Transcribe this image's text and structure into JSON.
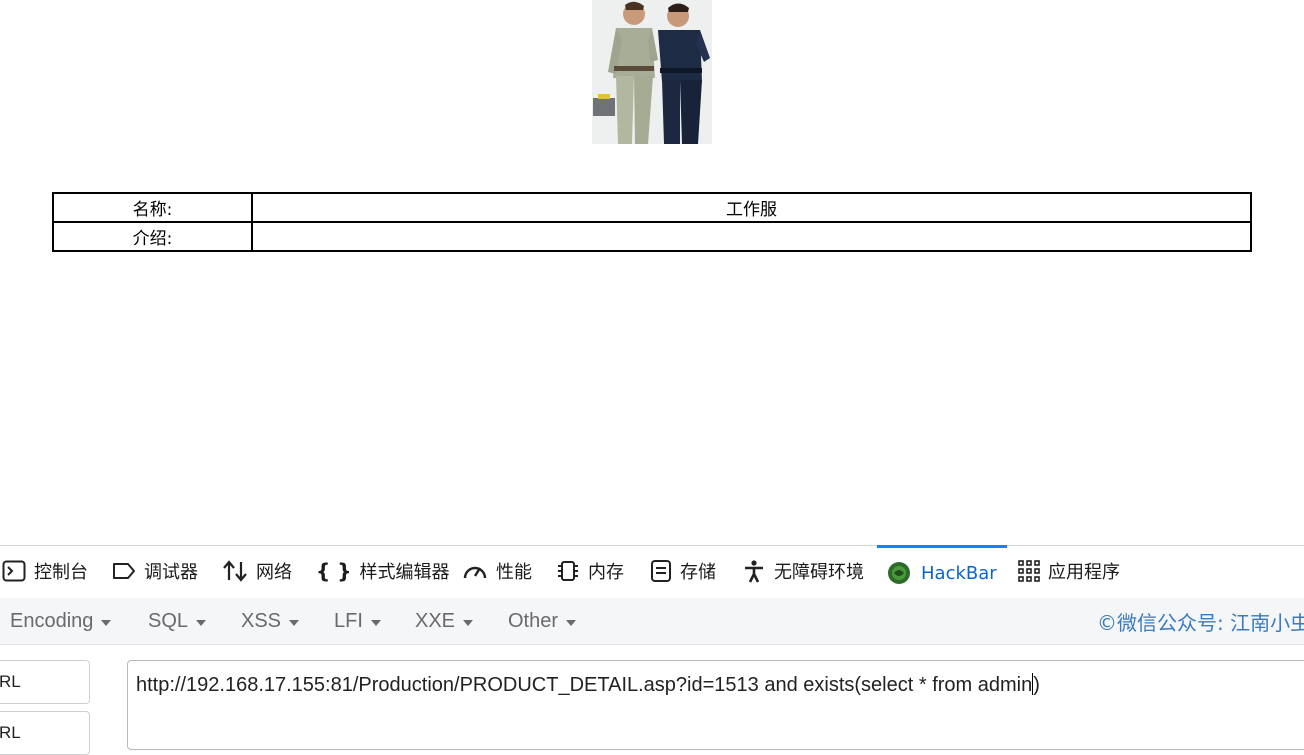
{
  "product": {
    "image_alt": "product photo: two men in work uniforms",
    "rows": [
      {
        "label": "名称:",
        "value": "工作服"
      },
      {
        "label": "介绍:",
        "value": ""
      }
    ]
  },
  "devtools": {
    "tabs": [
      {
        "label": "控制台",
        "icon": "console-icon"
      },
      {
        "label": "调试器",
        "icon": "debugger-icon"
      },
      {
        "label": "网络",
        "icon": "network-icon"
      },
      {
        "label": "样式编辑器",
        "icon": "style-editor-icon"
      },
      {
        "label": "性能",
        "icon": "performance-icon"
      },
      {
        "label": "内存",
        "icon": "memory-icon"
      },
      {
        "label": "存储",
        "icon": "storage-icon"
      },
      {
        "label": "无障碍环境",
        "icon": "accessibility-icon"
      },
      {
        "label": "HackBar",
        "icon": "hackbar-icon",
        "active": true
      },
      {
        "label": "应用程序",
        "icon": "application-icon"
      }
    ],
    "active_color": "#0a84ff"
  },
  "hackbar": {
    "menus": [
      "Encoding",
      "SQL",
      "XSS",
      "LFI",
      "XXE",
      "Other"
    ],
    "watermark": "©微信公众号: 江南小虫",
    "side_buttons": [
      "RL",
      "RL"
    ],
    "url_value": "http://192.168.17.155:81/Production/PRODUCT_DETAIL.asp?id=1513 and exists(select * from admin)",
    "url_before_cursor": "http://192.168.17.155:81/Production/PRODUCT_DETAIL.asp?id=1513 and exists(select * from admin",
    "url_after_cursor": ")"
  }
}
